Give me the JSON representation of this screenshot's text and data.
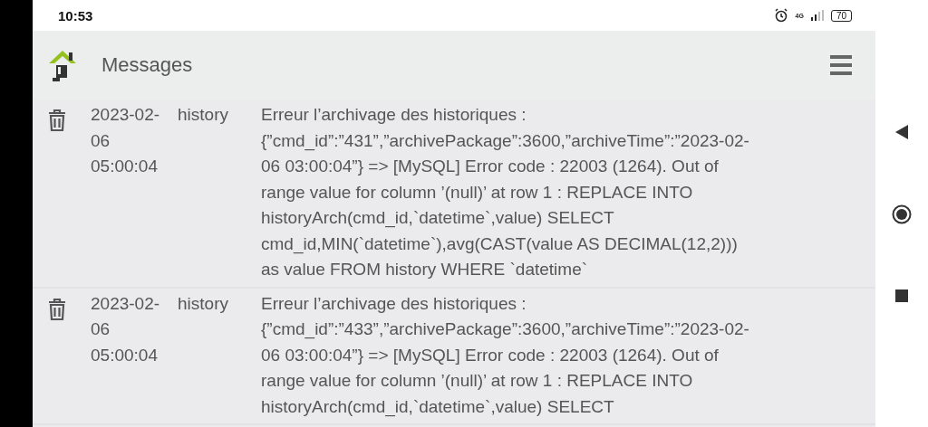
{
  "status_bar": {
    "time": "10:53",
    "network": "4G",
    "battery": "70"
  },
  "header": {
    "title": "Messages"
  },
  "messages": [
    {
      "date": "2023-02-06 05:00:04",
      "source": "history",
      "text": "Erreur l’archivage des historiques : {”cmd_id”:”431”,”archivePackage”:3600,”archiveTime”:”2023-02-06 03:00:04”} => [MySQL] Error code : 22003 (1264). Out of range value for column ’(null)’ at row 1 : REPLACE INTO historyArch(cmd_id,`datetime`,value) SELECT cmd_id,MIN(`datetime`),avg(CAST(value AS DECIMAL(12,2))) as value FROM history WHERE `datetime`"
    },
    {
      "date": "2023-02-06 05:00:04",
      "source": "history",
      "text": "Erreur l’archivage des historiques : {”cmd_id”:”433”,”archivePackage”:3600,”archiveTime”:”2023-02-06 03:00:04”} => [MySQL] Error code : 22003 (1264). Out of range value for column ’(null)’ at row 1 : REPLACE INTO historyArch(cmd_id,`datetime`,value) SELECT"
    }
  ]
}
